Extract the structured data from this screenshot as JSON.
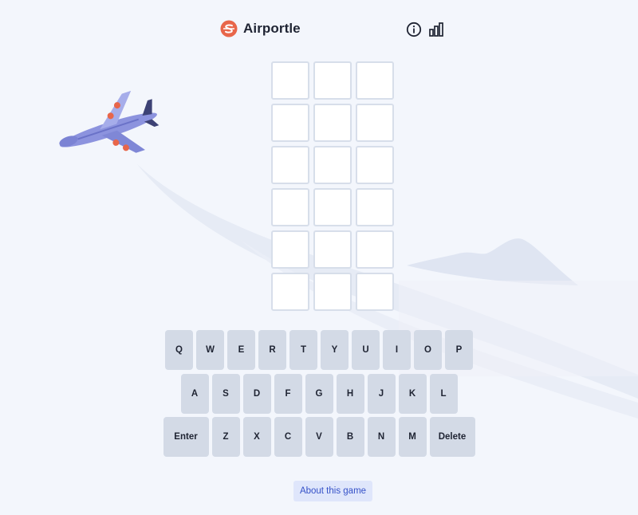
{
  "app": {
    "title": "Airportle",
    "logo_icon": "airportle-logo-icon",
    "accent_color": "#e8664a"
  },
  "header": {
    "info_icon": "info-circle-icon",
    "stats_icon": "bar-chart-icon"
  },
  "board": {
    "rows": 6,
    "cols": 3,
    "cells": [
      [
        "",
        "",
        ""
      ],
      [
        "",
        "",
        ""
      ],
      [
        "",
        "",
        ""
      ],
      [
        "",
        "",
        ""
      ],
      [
        "",
        "",
        ""
      ],
      [
        "",
        "",
        ""
      ]
    ]
  },
  "keyboard": {
    "row1": [
      "Q",
      "W",
      "E",
      "R",
      "T",
      "Y",
      "U",
      "I",
      "O",
      "P"
    ],
    "row2": [
      "A",
      "S",
      "D",
      "F",
      "G",
      "H",
      "J",
      "K",
      "L"
    ],
    "row3": [
      "Enter",
      "Z",
      "X",
      "C",
      "V",
      "B",
      "N",
      "M",
      "Delete"
    ],
    "key_color": "#d3dae6"
  },
  "footer": {
    "about_label": "About this game"
  }
}
